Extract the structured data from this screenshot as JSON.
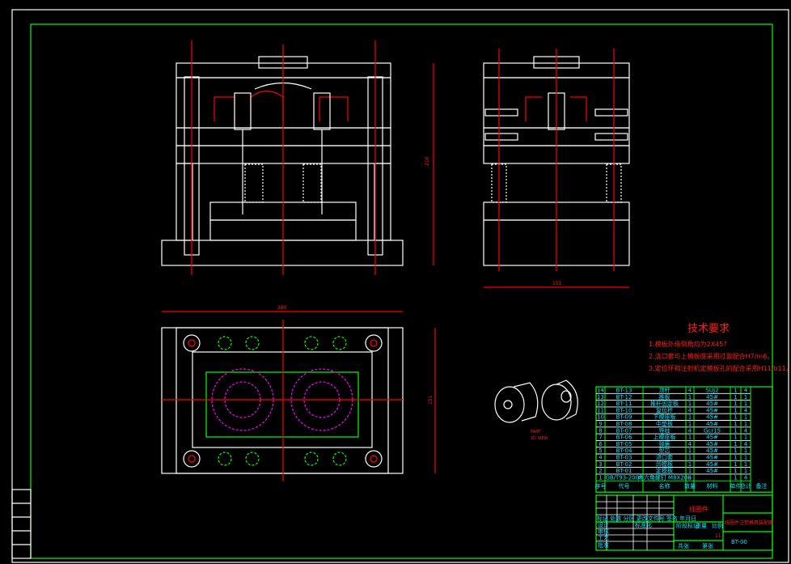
{
  "tech_requirements": {
    "title": "技术要求",
    "items": [
      "1.模板外缘倒角均为2X45?",
      "2.浇口套与上模板座采用过盈配合H7/m6。",
      "3.定位环和注射机定模板孔的配合采用H11/b11。"
    ]
  },
  "dimensions": {
    "front_height": "210",
    "side_width": "151",
    "top_width": "280",
    "top_height": "151"
  },
  "part_label": [
    "PART",
    "3D VIEW"
  ],
  "bom": {
    "headers": [
      "序号",
      "代号",
      "名称",
      "数量",
      "材料",
      "单件",
      "总计",
      "备注"
    ],
    "rows": [
      [
        "14",
        "BT-13",
        "顶杆",
        "4",
        "SUJ2",
        "1",
        "4"
      ],
      [
        "13",
        "BT-12",
        "推板",
        "1",
        "45#",
        "1",
        "1"
      ],
      [
        "12",
        "BT-11",
        "推杆固定板",
        "1",
        "45#",
        "1",
        "1"
      ],
      [
        "11",
        "BT-10",
        "复位杆",
        "4",
        "45#",
        "1",
        "4"
      ],
      [
        "10",
        "BT-09",
        "下模座板",
        "1",
        "45#",
        "1",
        "1"
      ],
      [
        "9",
        "BT-08",
        "中垫板",
        "1",
        "45#",
        "1",
        "1"
      ],
      [
        "8",
        "BT-07",
        "导柱",
        "4",
        "Gcr15",
        "1",
        "4"
      ],
      [
        "7",
        "BT-06",
        "上模座板",
        "1",
        "45#",
        "1",
        "1"
      ],
      [
        "6",
        "BT-05",
        "弹簧",
        "4",
        "45#",
        "1",
        "4"
      ],
      [
        "5",
        "BT-04",
        "型芯",
        "1",
        "45#",
        "1",
        "1"
      ],
      [
        "4",
        "BT-03",
        "浇口套",
        "1",
        "45#",
        "1",
        "1"
      ],
      [
        "3",
        "BT-02",
        "凹模板",
        "1",
        "45#",
        "1",
        "1"
      ],
      [
        "2",
        "BT-01",
        "定模板",
        "1",
        "45#",
        "1",
        "1"
      ],
      [
        "1",
        "GB/T93-2008",
        "内六角螺钉 M8X20L",
        "4",
        "",
        "1",
        "4"
      ]
    ]
  },
  "title_block": {
    "part_name": "线圈件",
    "drawing_title": "线圈件注塑模具装配图",
    "drawing_number": "BT-00",
    "sheet": "11",
    "labels": [
      "标记",
      "处数",
      "分区",
      "更改文件号",
      "签名",
      "年月日",
      "设计",
      "标准化",
      "审核",
      "工艺",
      "阶段标记",
      "重量",
      "比例",
      "共张",
      "第张",
      "批准"
    ]
  },
  "colors": {
    "frame": "#00ff00",
    "lines": "#ffffff",
    "hatch": "#00ff00",
    "centerline": "#ff0000",
    "text_table": "#00e5ff",
    "text_notes": "#ff1a1a",
    "hidden": "#ff00ff"
  }
}
